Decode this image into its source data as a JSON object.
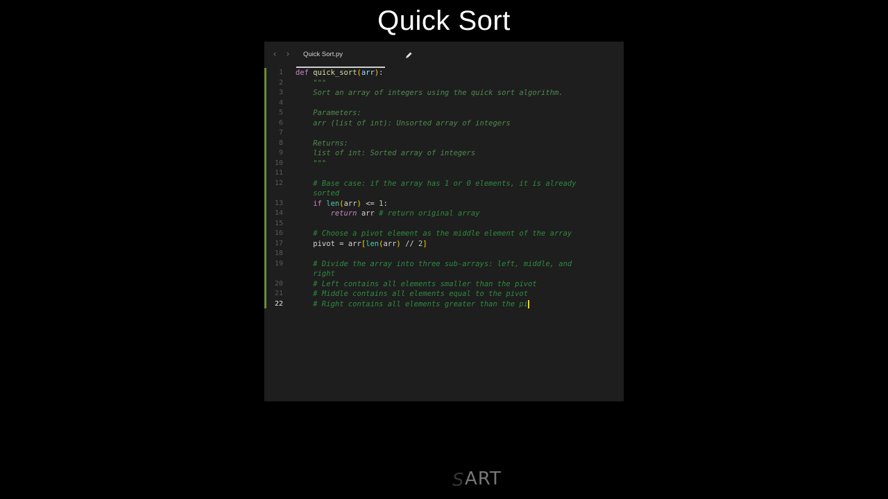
{
  "page": {
    "title": "Quick Sort",
    "watermark": "SART"
  },
  "editor": {
    "tab": {
      "filename": "Quick Sort.py",
      "icon": "pencil-icon",
      "nav_back_icon": "chevron-left-icon",
      "nav_forward_icon": "chevron-right-icon"
    },
    "active_line": 22,
    "lines": [
      {
        "n": "1",
        "segments": [
          [
            "def",
            "def"
          ],
          [
            "op",
            " "
          ],
          [
            "fn",
            "quick_sort"
          ],
          [
            "punc",
            "("
          ],
          [
            "var",
            "arr"
          ],
          [
            "punc",
            ")"
          ],
          [
            "op",
            ":"
          ]
        ]
      },
      {
        "n": "2",
        "segments": [
          [
            "str",
            "    \"\"\""
          ]
        ]
      },
      {
        "n": "3",
        "segments": [
          [
            "str",
            "    Sort an array of integers using the quick sort algorithm."
          ]
        ]
      },
      {
        "n": "4",
        "segments": []
      },
      {
        "n": "5",
        "segments": [
          [
            "str",
            "    Parameters:"
          ]
        ]
      },
      {
        "n": "6",
        "segments": [
          [
            "str",
            "    arr (list of int): Unsorted array of integers"
          ]
        ]
      },
      {
        "n": "7",
        "segments": []
      },
      {
        "n": "8",
        "segments": [
          [
            "str",
            "    Returns:"
          ]
        ]
      },
      {
        "n": "9",
        "segments": [
          [
            "str",
            "    list of int: Sorted array of integers"
          ]
        ]
      },
      {
        "n": "10",
        "segments": [
          [
            "str",
            "    \"\"\""
          ]
        ]
      },
      {
        "n": "11",
        "segments": []
      },
      {
        "n": "12",
        "segments": [
          [
            "cmt",
            "    # Base case: if the array has 1 or 0 elements, it is already"
          ]
        ]
      },
      {
        "n": "",
        "segments": [
          [
            "cmt",
            "    sorted"
          ]
        ]
      },
      {
        "n": "13",
        "segments": [
          [
            "op",
            "    "
          ],
          [
            "kw",
            "if"
          ],
          [
            "op",
            " "
          ],
          [
            "bi",
            "len"
          ],
          [
            "punc",
            "("
          ],
          [
            "op",
            "arr"
          ],
          [
            "punc",
            ")"
          ],
          [
            "op",
            " <= "
          ],
          [
            "num",
            "1"
          ],
          [
            "op",
            ":"
          ]
        ]
      },
      {
        "n": "14",
        "segments": [
          [
            "op",
            "        "
          ],
          [
            "ret",
            "return"
          ],
          [
            "op",
            " arr "
          ],
          [
            "cmt",
            "# return original array"
          ]
        ]
      },
      {
        "n": "15",
        "segments": []
      },
      {
        "n": "16",
        "segments": [
          [
            "cmt",
            "    # Choose a pivot element as the middle element of the array"
          ]
        ]
      },
      {
        "n": "17",
        "segments": [
          [
            "op",
            "    pivot = arr"
          ],
          [
            "punc",
            "["
          ],
          [
            "bi",
            "len"
          ],
          [
            "punc",
            "("
          ],
          [
            "op",
            "arr"
          ],
          [
            "punc",
            ")"
          ],
          [
            "op",
            " // "
          ],
          [
            "num",
            "2"
          ],
          [
            "punc",
            "]"
          ]
        ]
      },
      {
        "n": "18",
        "segments": []
      },
      {
        "n": "19",
        "segments": [
          [
            "cmt",
            "    # Divide the array into three sub-arrays: left, middle, and"
          ]
        ]
      },
      {
        "n": "",
        "segments": [
          [
            "cmt",
            "    right"
          ]
        ]
      },
      {
        "n": "20",
        "segments": [
          [
            "cmt",
            "    # Left contains all elements smaller than the pivot"
          ]
        ]
      },
      {
        "n": "21",
        "segments": [
          [
            "cmt",
            "    # Middle contains all elements equal to the pivot"
          ]
        ]
      },
      {
        "n": "22",
        "segments": [
          [
            "cmt",
            "    # Right contains all elements greater than the pi"
          ]
        ],
        "cursor": true
      }
    ]
  }
}
